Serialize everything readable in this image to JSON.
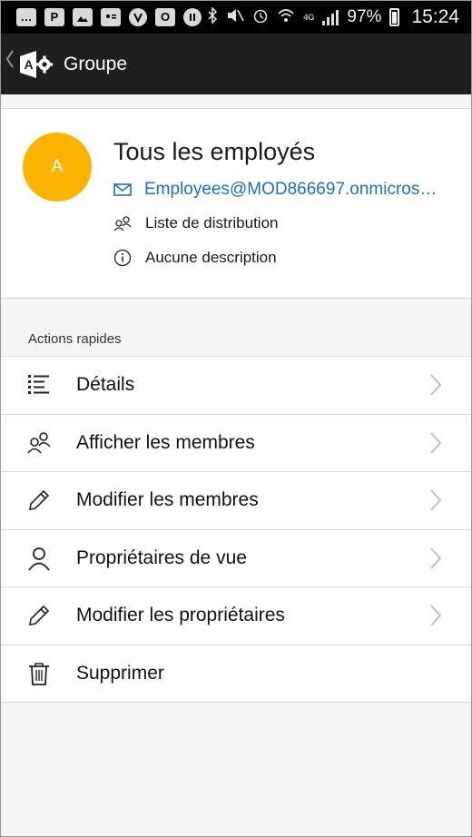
{
  "status_bar": {
    "battery": "97%",
    "time": "15:24",
    "network": "4G",
    "icons": [
      "chat-icon",
      "p-icon",
      "image-icon",
      "id-card-icon",
      "shield-icon",
      "outlook-icon",
      "pause-icon",
      "bluetooth-icon",
      "mute-icon",
      "alarm-icon",
      "wifi-icon",
      "signal-icon",
      "battery-icon"
    ]
  },
  "app_bar": {
    "title": "Groupe",
    "back_icon": "chevron-left-icon",
    "logo_icon": "admin-logo-icon"
  },
  "profile": {
    "avatar_letter": "A",
    "avatar_color": "#f8b400",
    "name": "Tous les employés",
    "email": "Employees@MOD866697.onmicros…",
    "type": "Liste de distribution",
    "description": "Aucune description"
  },
  "quick_actions": {
    "header": "Actions rapides",
    "items": [
      {
        "label": "Détails",
        "icon": "list-icon",
        "chevron": true
      },
      {
        "label": "Afficher les membres",
        "icon": "people-icon",
        "chevron": true
      },
      {
        "label": "Modifier les membres",
        "icon": "pencil-icon",
        "chevron": true
      },
      {
        "label": "Propriétaires de vue",
        "icon": "person-icon",
        "chevron": true
      },
      {
        "label": "Modifier les propriétaires",
        "icon": "pencil-icon",
        "chevron": true
      },
      {
        "label": "Supprimer",
        "icon": "trash-icon",
        "chevron": false
      }
    ]
  },
  "colors": {
    "accent_link": "#1e6fb8",
    "app_bar": "#1f1f1f",
    "status_bar": "#000000"
  }
}
